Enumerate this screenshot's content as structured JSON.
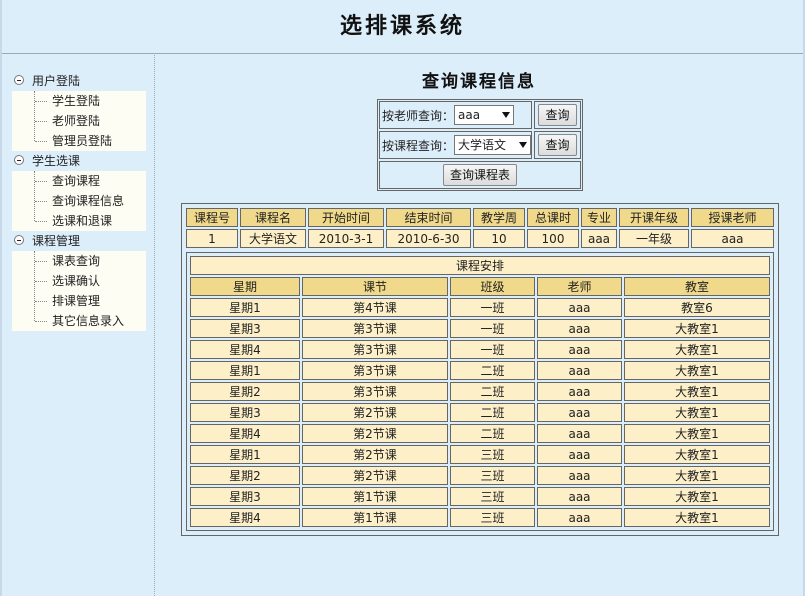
{
  "header": {
    "title": "选排课系统"
  },
  "sidebar": {
    "groups": [
      {
        "label": "用户登陆",
        "items": [
          "学生登陆",
          "老师登陆",
          "管理员登陆"
        ]
      },
      {
        "label": "学生选课",
        "items": [
          "查询课程",
          "查询课程信息",
          "选课和退课"
        ]
      },
      {
        "label": "课程管理",
        "items": [
          "课表查询",
          "选课确认",
          "排课管理",
          "其它信息录入"
        ]
      }
    ]
  },
  "main": {
    "title": "查询课程信息",
    "query": {
      "teacher_label": "按老师查询：",
      "teacher_value": "aaa",
      "teacher_button": "查询",
      "course_label": "按课程查询：",
      "course_value": "大学语文",
      "course_button": "查询",
      "schedule_button": "查询课程表"
    },
    "course_table": {
      "headers": [
        "课程号",
        "课程名",
        "开始时间",
        "结束时间",
        "教学周",
        "总课时",
        "专业",
        "开课年级",
        "授课老师"
      ],
      "row": [
        "1",
        "大学语文",
        "2010-3-1",
        "2010-6-30",
        "10",
        "100",
        "aaa",
        "一年级",
        "aaa"
      ]
    },
    "schedule": {
      "caption": "课程安排",
      "headers": [
        "星期",
        "课节",
        "班级",
        "老师",
        "教室"
      ],
      "rows": [
        [
          "星期1",
          "第4节课",
          "一班",
          "aaa",
          "教室6"
        ],
        [
          "星期3",
          "第3节课",
          "一班",
          "aaa",
          "大教室1"
        ],
        [
          "星期4",
          "第3节课",
          "一班",
          "aaa",
          "大教室1"
        ],
        [
          "星期1",
          "第3节课",
          "二班",
          "aaa",
          "大教室1"
        ],
        [
          "星期2",
          "第3节课",
          "二班",
          "aaa",
          "大教室1"
        ],
        [
          "星期3",
          "第2节课",
          "二班",
          "aaa",
          "大教室1"
        ],
        [
          "星期4",
          "第2节课",
          "二班",
          "aaa",
          "大教室1"
        ],
        [
          "星期1",
          "第2节课",
          "三班",
          "aaa",
          "大教室1"
        ],
        [
          "星期2",
          "第2节课",
          "三班",
          "aaa",
          "大教室1"
        ],
        [
          "星期3",
          "第1节课",
          "三班",
          "aaa",
          "大教室1"
        ],
        [
          "星期4",
          "第1节课",
          "三班",
          "aaa",
          "大教室1"
        ]
      ]
    }
  }
}
